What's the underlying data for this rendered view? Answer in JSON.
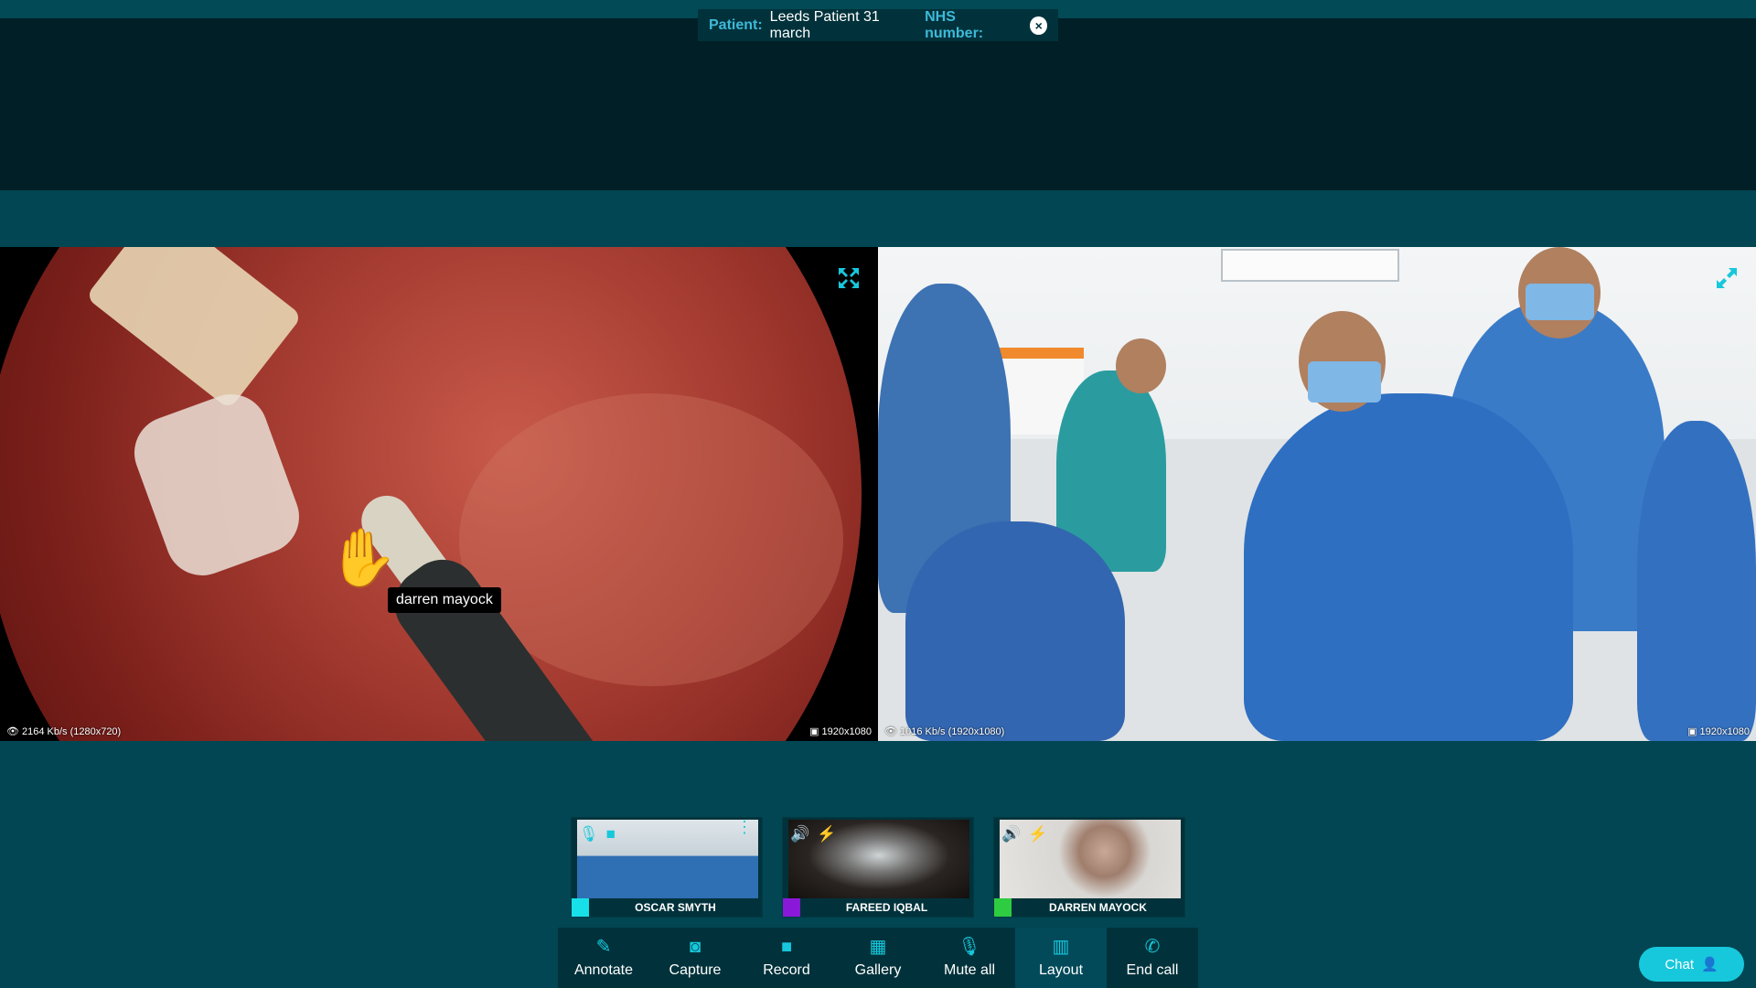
{
  "patient_bar": {
    "patient_label": "Patient:",
    "patient_name": "Leeds Patient 31 march",
    "nhs_label": "NHS number:",
    "nhs_value": ""
  },
  "feeds": {
    "left": {
      "pointer_label": "darren mayock",
      "bitrate": "2164 Kb/s (1280x720)",
      "resolution": "1920x1080"
    },
    "right": {
      "bitrate": "1016 Kb/s (1920x1080)",
      "resolution": "1920x1080"
    }
  },
  "participants": [
    {
      "name": "OSCAR SMYTH",
      "color": "#17e0e8",
      "icons": [
        "microphone-icon",
        "video-camera-icon"
      ],
      "menu": true
    },
    {
      "name": "FAREED IQBAL",
      "color": "#8a18d8",
      "icons": [
        "speaker-icon",
        "plug-icon"
      ],
      "menu": false
    },
    {
      "name": "DARREN MAYOCK",
      "color": "#2ecc40",
      "icons": [
        "speaker-icon",
        "plug-icon"
      ],
      "menu": false
    }
  ],
  "toolbar": {
    "annotate": "Annotate",
    "capture": "Capture",
    "record": "Record",
    "gallery": "Gallery",
    "mute_all": "Mute all",
    "layout": "Layout",
    "end_call": "End call"
  },
  "chat": {
    "label": "Chat"
  },
  "colors": {
    "accent": "#17c8dc",
    "background": "#014652",
    "panel": "#01323b",
    "pointer": "#2ecc40"
  }
}
